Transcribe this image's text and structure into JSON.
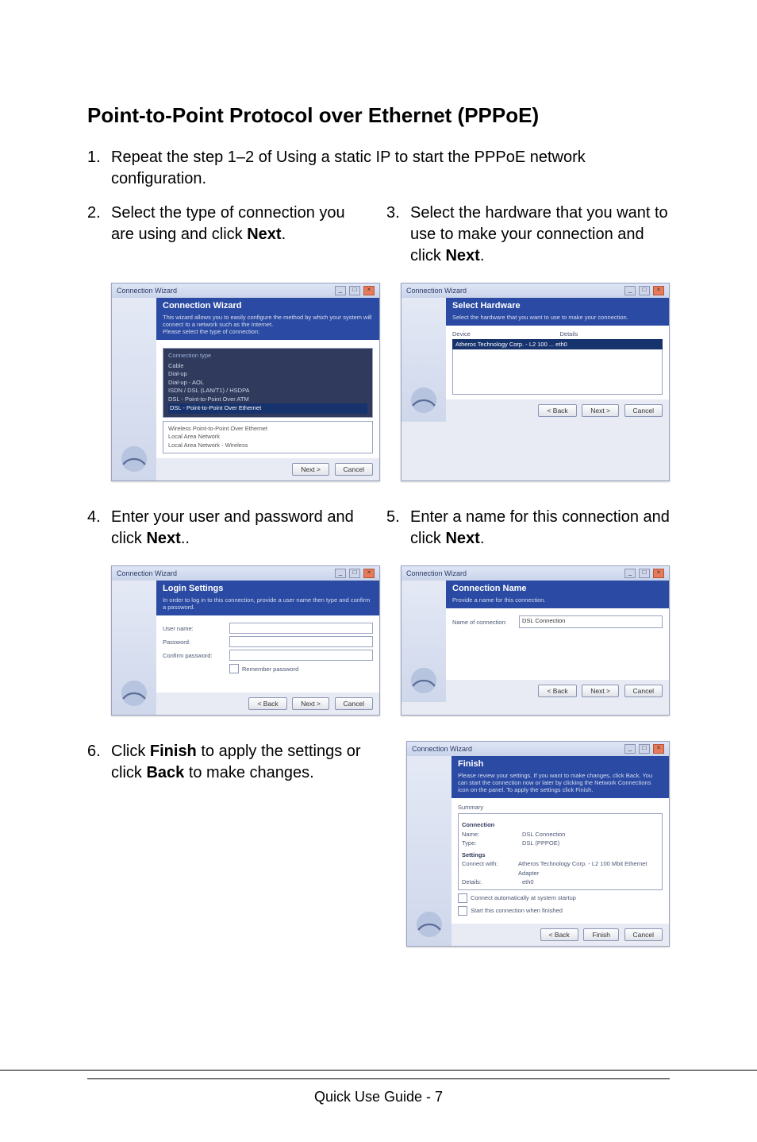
{
  "page": {
    "title": "Point-to-Point Protocol over Ethernet (PPPoE)",
    "footer": "Quick Use Guide - 7"
  },
  "steps": {
    "s1": {
      "num": "1.",
      "text": "Repeat the step 1–2 of Using a static IP to start the PPPoE network configuration."
    },
    "s2": {
      "num": "2.",
      "text_a": "Select the type of connection you are using and click ",
      "bold": "Next",
      "text_b": "."
    },
    "s3": {
      "num": "3.",
      "text_a": "Select the hardware that you want to use to make your connection and click ",
      "bold": "Next",
      "text_b": "."
    },
    "s4": {
      "num": "4.",
      "text_a": "Enter your user and password and click ",
      "bold": "Next",
      "text_b": ".."
    },
    "s5": {
      "num": "5.",
      "text_a": "Enter a name for this connection and click ",
      "bold": "Next",
      "text_b": "."
    },
    "s6": {
      "num": "6.",
      "text_a": "Click ",
      "bold1": "Finish",
      "text_b": " to apply the settings or click ",
      "bold2": "Back",
      "text_c": " to make changes."
    }
  },
  "win_common": {
    "title": "Connection Wizard",
    "back": "< Back",
    "next": "Next >",
    "cancel": "Cancel",
    "finish": "Finish"
  },
  "win2": {
    "head": "Connection Wizard",
    "sub1": "This wizard allows you to easily configure the method by which your system will connect to a network such as the Internet.",
    "sub2": "Please select the type of connection:",
    "cat_hdr": "Connection type",
    "items": [
      "Cable",
      "Dial-up",
      "Dial-up - AOL",
      "ISDN / DSL (LAN/T1) / HSDPA",
      "DSL - Point-to-Point Over ATM"
    ],
    "sel": "DSL - Point-to-Point Over Ethernet",
    "items2": [
      "Wireless Point-to-Point Over Ethernet",
      "Local Area Network",
      "Local Area Network - Wireless"
    ]
  },
  "win3": {
    "head": "Select Hardware",
    "sub": "Select the hardware that you want to use to make your connection.",
    "col1": "Device",
    "col2": "Details",
    "row": "Atheros Technology Corp. - L2 100 ... eth0"
  },
  "win4": {
    "head": "Login Settings",
    "sub": "In order to log in to this connection, provide a user name then type and confirm a password.",
    "l_user": "User name:",
    "l_pass": "Password:",
    "l_conf": "Confirm password:",
    "remember": "Remember password"
  },
  "win5": {
    "head": "Connection Name",
    "sub": "Provide a name for this connection.",
    "l_name": "Name of connection:",
    "val": "DSL Connection"
  },
  "win6": {
    "head": "Finish",
    "sub": "Please review your settings. If you want to make changes, click Back. You can start the connection now or later by clicking the Network Connections icon on the panel. To apply the settings click Finish.",
    "hdr_sum": "Summary",
    "sec_conn": "Connection",
    "k_name": "Name:",
    "v_name": "DSL Connection",
    "k_type": "Type:",
    "v_type": "DSL (PPPOE)",
    "sec_set": "Settings",
    "k_conn": "Connect with:",
    "v_conn": "Atheros Technology Corp. - L2 100 Mbit Ethernet Adapter",
    "k_det": "Details:",
    "v_det": "eth0",
    "chk1": "Connect automatically at system startup",
    "chk2": "Start this connection when finished"
  }
}
